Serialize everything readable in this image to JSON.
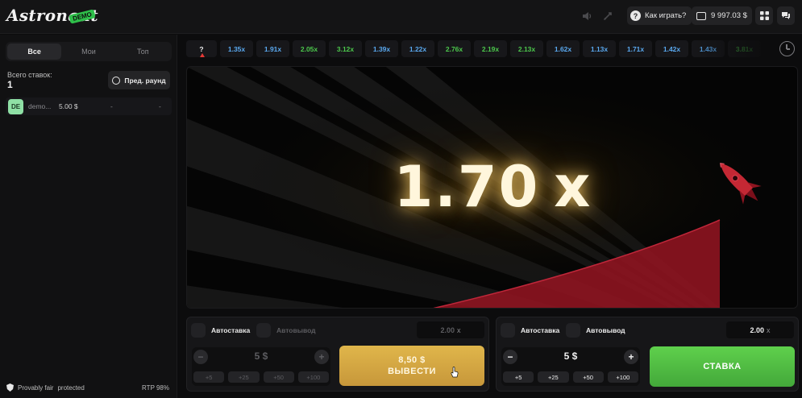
{
  "header": {
    "logo": "Astronaut",
    "demo_badge": "DEMO",
    "how_to_play": "Как играть?",
    "balance": "9 997.03 $",
    "icons": [
      "sound-icon",
      "animation-icon",
      "question-icon",
      "wallet-icon",
      "menu-grid-icon",
      "chat-icon"
    ]
  },
  "left_panel": {
    "tabs": [
      "Все",
      "Мои",
      "Топ"
    ],
    "active_tab": "Все",
    "total_bets_label": "Всего ставок:",
    "total_bets_count": "1",
    "prev_round_label": "Пред. раунд",
    "bets": [
      {
        "avatar": "DE",
        "user": "demo...",
        "amount": "5.00 $",
        "coef": "-",
        "win": "-"
      }
    ],
    "provably_fair": "Provably fair",
    "provably_fair_status": "protected",
    "rtp": "RTP 98%"
  },
  "history": [
    {
      "value": "?",
      "color": "#f0f0f0"
    },
    {
      "value": "1.35x",
      "color": "#5aa9f0"
    },
    {
      "value": "1.91x",
      "color": "#5aa9f0"
    },
    {
      "value": "2.05x",
      "color": "#4cc84c"
    },
    {
      "value": "3.12x",
      "color": "#4cc84c"
    },
    {
      "value": "1.39x",
      "color": "#5aa9f0"
    },
    {
      "value": "1.22x",
      "color": "#5aa9f0"
    },
    {
      "value": "2.76x",
      "color": "#4cc84c"
    },
    {
      "value": "2.19x",
      "color": "#4cc84c"
    },
    {
      "value": "2.13x",
      "color": "#4cc84c"
    },
    {
      "value": "1.62x",
      "color": "#5aa9f0"
    },
    {
      "value": "1.13x",
      "color": "#5aa9f0"
    },
    {
      "value": "1.71x",
      "color": "#5aa9f0"
    },
    {
      "value": "1.42x",
      "color": "#5aa9f0"
    },
    {
      "value": "1.43x",
      "color": "#5aa9f0"
    },
    {
      "value": "3.81x",
      "color": "#4cc84c"
    }
  ],
  "game": {
    "multiplier_value": "1.70",
    "multiplier_unit": "x"
  },
  "panel_left": {
    "autobet_label": "Автоставка",
    "autocashout_label": "Автовывод",
    "auto_coef_value": "2.00",
    "auto_coef_unit": "x",
    "stake_amount": "5 $",
    "chips": [
      "+5",
      "+25",
      "+50",
      "+100"
    ],
    "cashout_amount": "8,50 $",
    "cashout_label": "ВЫВЕСТИ"
  },
  "panel_right": {
    "autobet_label": "Автоставка",
    "autocashout_label": "Автовывод",
    "auto_coef_value": "2.00",
    "auto_coef_unit": "x",
    "stake_amount": "5 $",
    "chips": [
      "+5",
      "+25",
      "+50",
      "+100"
    ],
    "bet_label": "СТАВКА"
  },
  "colors": {
    "cashout": "#d4a843",
    "bet": "#52bf44",
    "curve": "#8e1420",
    "low_multiplier": "#5aa9f0",
    "high_multiplier": "#4cc84c"
  }
}
